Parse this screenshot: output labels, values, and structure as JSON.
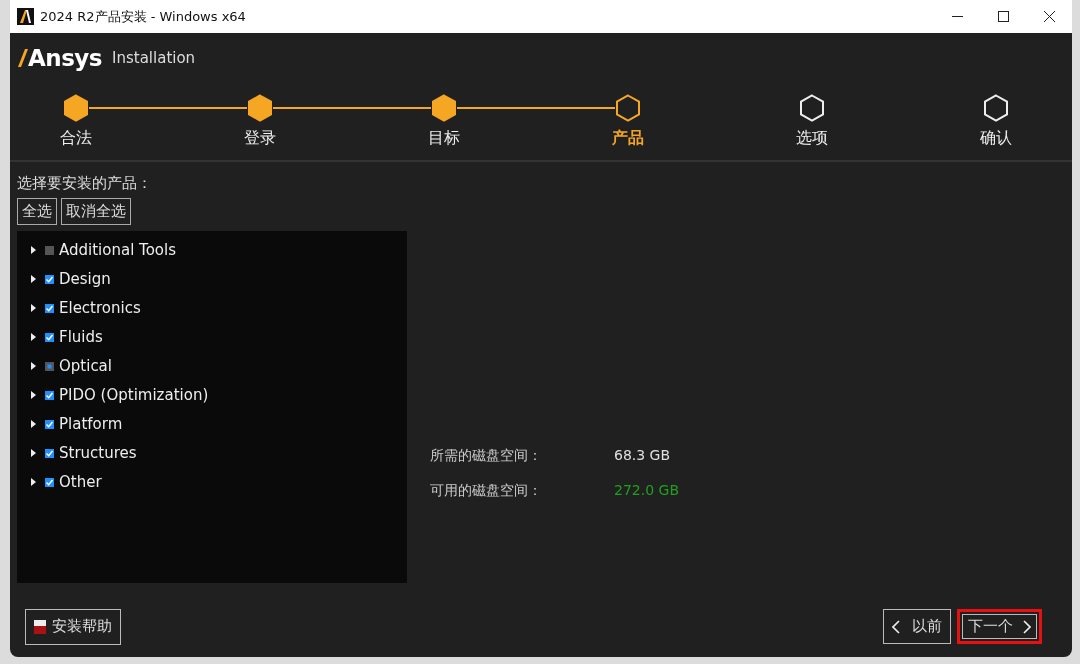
{
  "window": {
    "title": "2024 R2产品安装 - Windows x64"
  },
  "header": {
    "logo": "Ansys",
    "subtitle": "Installation"
  },
  "steps": [
    {
      "label": "合法",
      "done": true,
      "current": false
    },
    {
      "label": "登录",
      "done": true,
      "current": false
    },
    {
      "label": "目标",
      "done": true,
      "current": false
    },
    {
      "label": "产品",
      "done": false,
      "current": true
    },
    {
      "label": "选项",
      "done": false,
      "current": false
    },
    {
      "label": "确认",
      "done": false,
      "current": false
    }
  ],
  "prompt": "选择要安装的产品：",
  "select_buttons": [
    "全选",
    "取消全选"
  ],
  "products": [
    {
      "label": "Additional Tools",
      "checked": false,
      "partial": false
    },
    {
      "label": "Design",
      "checked": true,
      "partial": false
    },
    {
      "label": "Electronics",
      "checked": true,
      "partial": false
    },
    {
      "label": "Fluids",
      "checked": true,
      "partial": false
    },
    {
      "label": "Optical",
      "checked": false,
      "partial": true
    },
    {
      "label": "PIDO (Optimization)",
      "checked": true,
      "partial": false
    },
    {
      "label": "Platform",
      "checked": true,
      "partial": false
    },
    {
      "label": "Structures",
      "checked": true,
      "partial": false
    },
    {
      "label": "Other",
      "checked": true,
      "partial": false
    }
  ],
  "disk": [
    {
      "label": "所需的磁盘空间：",
      "value": "68.3 GB",
      "color": "#e0e0e0"
    },
    {
      "label": "可用的磁盘空间：",
      "value": "272.0 GB",
      "color": "#1fa01f"
    }
  ],
  "help_button": "安装帮助",
  "nav_buttons": [
    {
      "label": "以前",
      "kind": "back",
      "highlighted": false
    },
    {
      "label": "下一个",
      "kind": "next",
      "highlighted": true
    }
  ]
}
